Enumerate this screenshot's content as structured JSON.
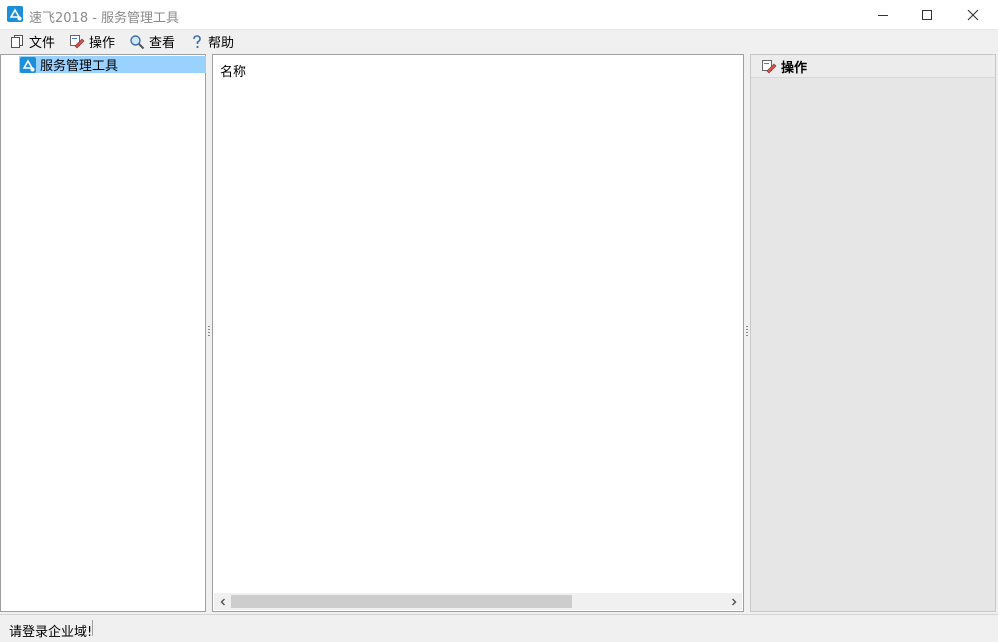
{
  "window": {
    "title": "速飞2018 - 服务管理工具",
    "controls": [
      "minimize",
      "maximize",
      "close"
    ]
  },
  "menu": {
    "items": [
      {
        "label": "文件",
        "icon": "copy-icon"
      },
      {
        "label": "操作",
        "icon": "edit-icon"
      },
      {
        "label": "查看",
        "icon": "magnifier-icon"
      },
      {
        "label": "帮助",
        "icon": "question-icon"
      }
    ]
  },
  "tree": {
    "root": {
      "label": "服务管理工具",
      "selected": true,
      "icon": "app-node-icon"
    }
  },
  "list": {
    "columns": [
      "名称"
    ]
  },
  "actions": {
    "title": "操作",
    "icon": "edit-icon"
  },
  "status": {
    "text": "请登录企业域!"
  },
  "colors": {
    "selection": "#99d1ff",
    "accent": "#1b8fd8",
    "title_text": "#8a8a8a"
  }
}
